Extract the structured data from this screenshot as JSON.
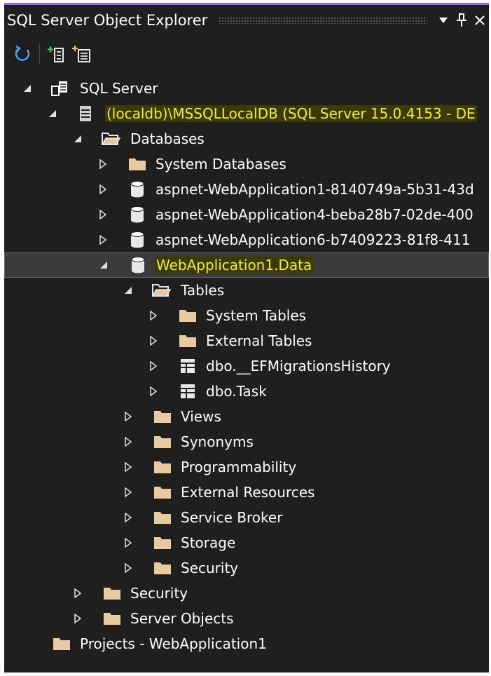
{
  "window": {
    "title": "SQL Server Object Explorer",
    "dropdown_glyph": "▾",
    "pin_glyph": "⊥",
    "close_glyph": "✕",
    "accent_color": "#8b6fe0",
    "highlight_color": "#f2f01a"
  },
  "toolbar": {
    "buttons": [
      {
        "name": "refresh-icon"
      },
      {
        "name": "add-sql-server-icon"
      },
      {
        "name": "add-database-icon"
      }
    ]
  },
  "tree": {
    "sql_server": "SQL Server",
    "instance": "(localdb)\\MSSQLLocalDB (SQL Server 15.0.4153 - DE",
    "databases": "Databases",
    "system_databases": "System Databases",
    "db1": "aspnet-WebApplication1-8140749a-5b31-43d",
    "db2": "aspnet-WebApplication4-beba28b7-02de-400",
    "db3": "aspnet-WebApplication6-b7409223-81f8-411",
    "selected_db": "WebApplication1.Data",
    "tables": "Tables",
    "system_tables": "System Tables",
    "external_tables": "External Tables",
    "table_migrations": "dbo.__EFMigrationsHistory",
    "table_task": "dbo.Task",
    "views": "Views",
    "synonyms": "Synonyms",
    "programmability": "Programmability",
    "external_resources": "External Resources",
    "service_broker": "Service Broker",
    "storage": "Storage",
    "db_security": "Security",
    "server_security": "Security",
    "server_objects": "Server Objects",
    "projects": "Projects - WebApplication1"
  }
}
